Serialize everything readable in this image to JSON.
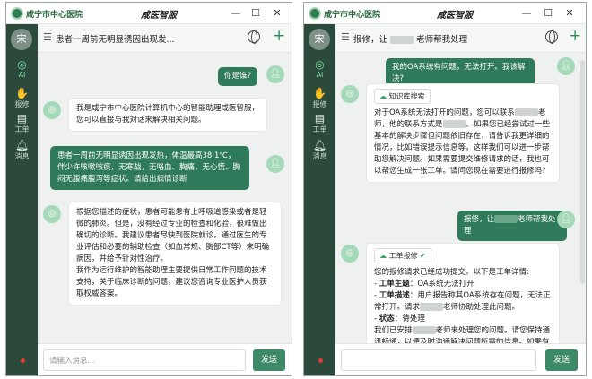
{
  "app": {
    "name": "咸宁市中心医院",
    "slogan": "咸医智服"
  },
  "window_buttons": {
    "minimize": "—",
    "maximize": "☐",
    "close": "✕"
  },
  "sidebar": {
    "avatar": "宋",
    "items": [
      {
        "label": "AI",
        "icon": "ai-icon"
      },
      {
        "label": "报修",
        "icon": "hand-icon"
      },
      {
        "label": "工单",
        "icon": "clipboard-icon"
      },
      {
        "label": "消息",
        "icon": "bell-icon"
      }
    ]
  },
  "left": {
    "conversation_title": "患者一周前无明显诱因出现发...",
    "messages": [
      {
        "role": "user",
        "text": "你是谁?"
      },
      {
        "role": "bot",
        "text": "我是咸宁市中心医院计算机中心的智能助理咸医智服，您可以直接与我对话来解决相关问题。"
      },
      {
        "role": "user",
        "text": "患者一周前无明显诱因出现发热，体温最高38.1℃，伴少许咳嗽咳痰，无寒战，无咯血、胸痛，无心慌、胸闷无腹痛腹泻等症状。请给出病情诊断"
      },
      {
        "role": "bot",
        "text": "根据您描述的症状，患者可能患有上呼吸道感染或者是轻微的肺炎。但是，没有经过专业的检查和化验，很难做出确切的诊断。我建议患者尽快到医院就诊，通过医生的专业评估和必要的辅助检查（如血常规、胸部CT等）来明确病因，并给予针对性治疗。\n我作为运行维护的智能助理主要提供日常工作问题的技术支持，关于临床诊断的问题，建议您咨询专业医护人员获取权威答案。"
      }
    ],
    "input_placeholder": "请输入消息...",
    "send_label": "发送"
  },
  "right": {
    "conversation_title_a": "报修，让",
    "conversation_title_b": "老师帮我处理",
    "messages": [
      {
        "role": "user",
        "text": "我的OA系统有问题，无法打开。我该解决?"
      },
      {
        "role": "bot",
        "tag": "知识库搜索",
        "text_a": "对于OA系统无法打开的问题，您可以联系",
        "text_b": "老师，他的联系方式是",
        "text_c": "。如果您已经尝试过一些基本的解决步骤但问题依旧存在，请告诉我更详细的情况，比如错误提示信息等，这样我们可以进一步帮助您解决问题。如果需要提交维修请求的话，我也可以帮您生成一张工单。请问您现在需要进行报修吗?"
      },
      {
        "role": "user",
        "text_a": "报修，让",
        "text_b": "老师帮我处理"
      },
      {
        "role": "bot",
        "tag": "工单报修",
        "intro": "您的报修请求已经成功提交。以下是工单详情:",
        "lines": [
          {
            "key": "工单主题",
            "value": "OA系统无法打开"
          },
          {
            "key": "工单描述",
            "value": "用户报告称其OA系统存在问题，无法正常打开。请求"
          },
          {
            "key": "状态",
            "value": "待处理"
          }
        ],
        "desc_tail": "老师协助处理此问题。",
        "outro_a": "我们已安排",
        "outro_b": "老师来处理您的问题。请您保持通讯畅通，以便及时沟通解决问题所需的信息。如果有任何更新或需要进一步的帮助，请随"
      }
    ],
    "input_placeholder": "",
    "send_label": "发送"
  }
}
